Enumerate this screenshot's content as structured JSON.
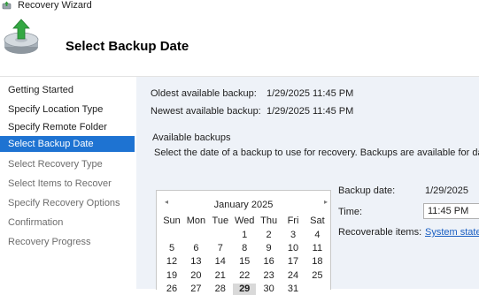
{
  "window": {
    "title": "Recovery Wizard"
  },
  "header": {
    "heading": "Select Backup Date"
  },
  "nav": {
    "items": [
      {
        "label": "Getting Started",
        "state": "done"
      },
      {
        "label": "Specify Location Type",
        "state": "done"
      },
      {
        "label": "Specify Remote Folder",
        "state": "done"
      },
      {
        "label": "Select Backup Date",
        "state": "active"
      },
      {
        "label": "Select Recovery Type",
        "state": "todo"
      },
      {
        "label": "Select Items to Recover",
        "state": "todo"
      },
      {
        "label": "Specify Recovery Options",
        "state": "todo"
      },
      {
        "label": "Confirmation",
        "state": "todo"
      },
      {
        "label": "Recovery Progress",
        "state": "todo"
      }
    ]
  },
  "info": {
    "oldest_label": "Oldest available backup:",
    "oldest_value": "1/29/2025 11:45 PM",
    "newest_label": "Newest available backup:",
    "newest_value": "1/29/2025 11:45 PM"
  },
  "backups": {
    "group_title": "Available backups",
    "description": "Select the date of a backup to use for recovery. Backups are available for dates"
  },
  "calendar": {
    "prev_icon": "◂",
    "next_icon": "▸",
    "month_label": "January 2025",
    "weekdays": [
      "Sun",
      "Mon",
      "Tue",
      "Wed",
      "Thu",
      "Fri",
      "Sat"
    ],
    "weeks": [
      [
        "",
        "",
        "",
        "1",
        "2",
        "3",
        "4"
      ],
      [
        "5",
        "6",
        "7",
        "8",
        "9",
        "10",
        "11"
      ],
      [
        "12",
        "13",
        "14",
        "15",
        "16",
        "17",
        "18"
      ],
      [
        "19",
        "20",
        "21",
        "22",
        "23",
        "24",
        "25"
      ],
      [
        "26",
        "27",
        "28",
        "29",
        "30",
        "31",
        ""
      ]
    ],
    "selected_day": "29"
  },
  "details": {
    "backup_date_label": "Backup date:",
    "backup_date_value": "1/29/2025",
    "time_label": "Time:",
    "time_value": "11:45 PM",
    "recoverable_label": "Recoverable items:",
    "recoverable_value": "System state"
  },
  "colors": {
    "nav_active": "#1e73d2",
    "content_bg": "#eef2f8",
    "link": "#1a5fc2"
  }
}
